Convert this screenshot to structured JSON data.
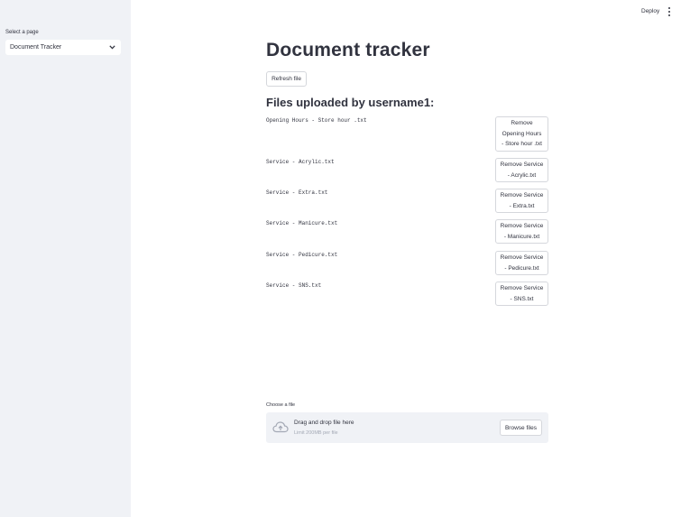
{
  "sidebar": {
    "select_label": "Select a page",
    "selected_page": "Document Tracker"
  },
  "header": {
    "deploy_label": "Deploy"
  },
  "main": {
    "title": "Document tracker",
    "refresh_label": "Refresh file",
    "files_heading": "Files uploaded by username1:",
    "files": [
      {
        "name": "Opening Hours - Store hour .txt",
        "remove_lines": [
          "Remove",
          "Opening Hours",
          "- Store hour .txt"
        ]
      },
      {
        "name": "Service - Acrylic.txt",
        "remove_lines": [
          "Remove Service",
          "- Acrylic.txt"
        ]
      },
      {
        "name": "Service - Extra.txt",
        "remove_lines": [
          "Remove Service",
          "- Extra.txt"
        ]
      },
      {
        "name": "Service - Manicure.txt",
        "remove_lines": [
          "Remove Service",
          "- Manicure.txt"
        ]
      },
      {
        "name": "Service - Pedicure.txt",
        "remove_lines": [
          "Remove Service",
          "- Pedicure.txt"
        ]
      },
      {
        "name": "Service - SNS.txt",
        "remove_lines": [
          "Remove Service",
          "- SNS.txt"
        ]
      }
    ]
  },
  "uploader": {
    "label": "Choose a file",
    "drop_text": "Drag and drop file here",
    "limit_text": "Limit 200MB per file",
    "browse_label": "Browse files",
    "icon": "cloud-upload-icon"
  },
  "colors": {
    "sidebar_bg": "#f0f2f6",
    "text": "#31333f",
    "border": "#d5d7dc",
    "muted": "#a3a8b4"
  }
}
